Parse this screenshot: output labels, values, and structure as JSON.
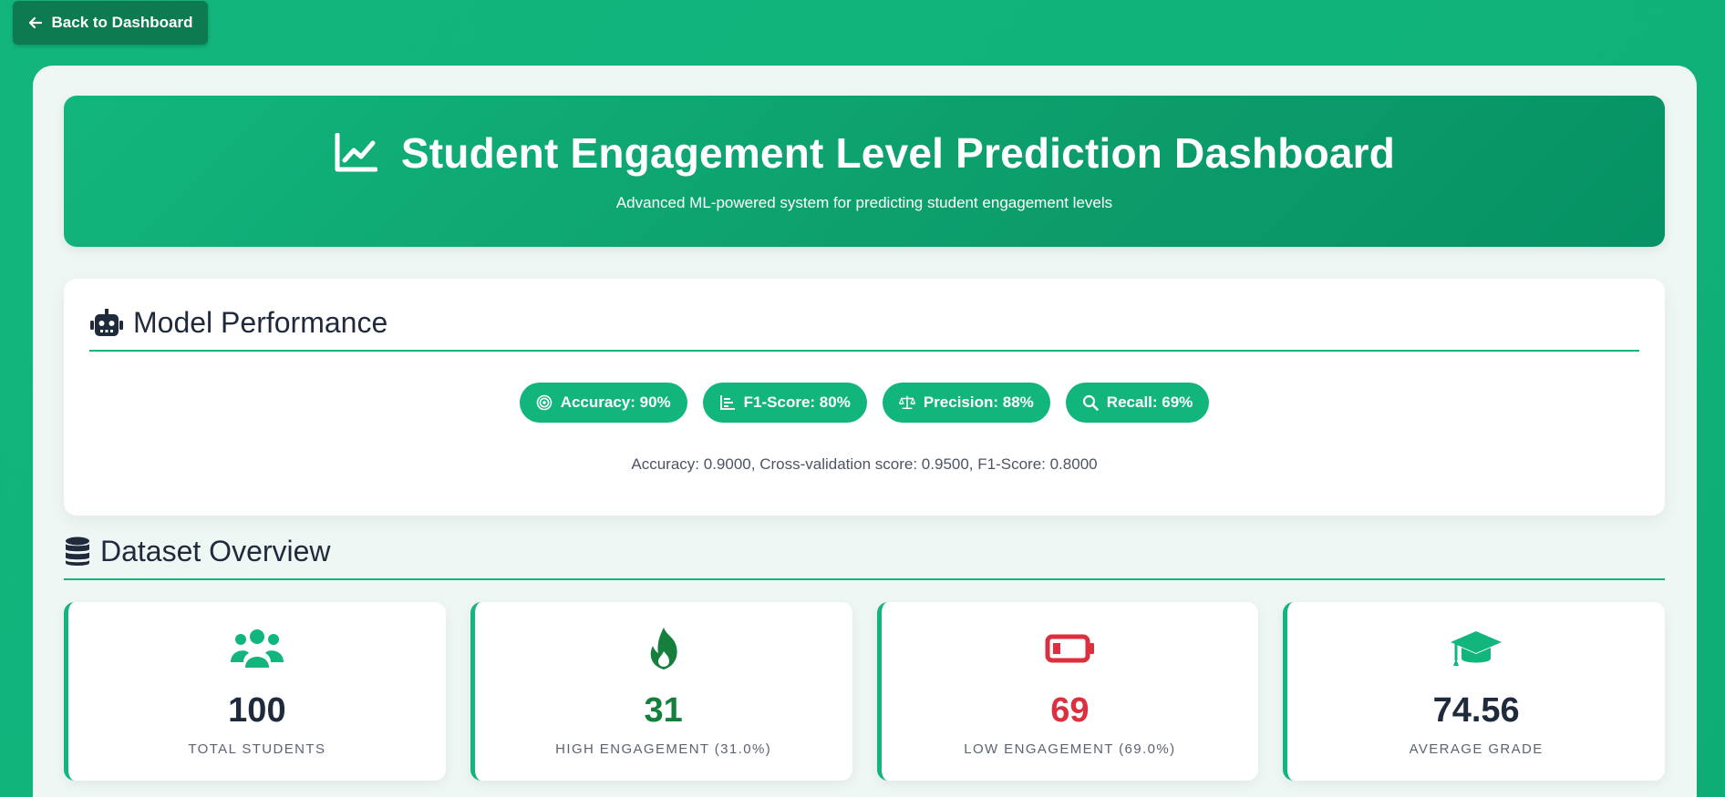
{
  "nav": {
    "back_label": "Back to Dashboard"
  },
  "hero": {
    "title": "Student Engagement Level Prediction Dashboard",
    "subtitle": "Advanced ML-powered system for predicting student engagement levels"
  },
  "model_performance": {
    "title": "Model Performance",
    "badges": [
      {
        "label": "Accuracy: 90%",
        "icon": "target-icon"
      },
      {
        "label": "F1-Score: 80%",
        "icon": "chart-bar-icon"
      },
      {
        "label": "Precision: 88%",
        "icon": "balance-scale-icon"
      },
      {
        "label": "Recall: 69%",
        "icon": "search-icon"
      }
    ],
    "detail": "Accuracy: 0.9000, Cross-validation score: 0.9500, F1-Score: 0.8000"
  },
  "dataset": {
    "title": "Dataset Overview",
    "stats": [
      {
        "value": "100",
        "label": "TOTAL STUDENTS",
        "icon": "users-icon",
        "color": "#1f2a3c",
        "icon_color": "#12b67d"
      },
      {
        "value": "31",
        "label": "HIGH ENGAGEMENT (31.0%)",
        "icon": "fire-icon",
        "color": "#15803d",
        "icon_color": "#15803d"
      },
      {
        "value": "69",
        "label": "LOW ENGAGEMENT (69.0%)",
        "icon": "battery-low-icon",
        "color": "#dc2f3f",
        "icon_color": "#dc2f3f"
      },
      {
        "value": "74.56",
        "label": "AVERAGE GRADE",
        "icon": "graduation-cap-icon",
        "color": "#1f2a3c",
        "icon_color": "#12b67d"
      }
    ]
  },
  "colors": {
    "accent": "#12b67d",
    "button_dark": "#0d7a4f",
    "heading": "#1f2a3c"
  }
}
